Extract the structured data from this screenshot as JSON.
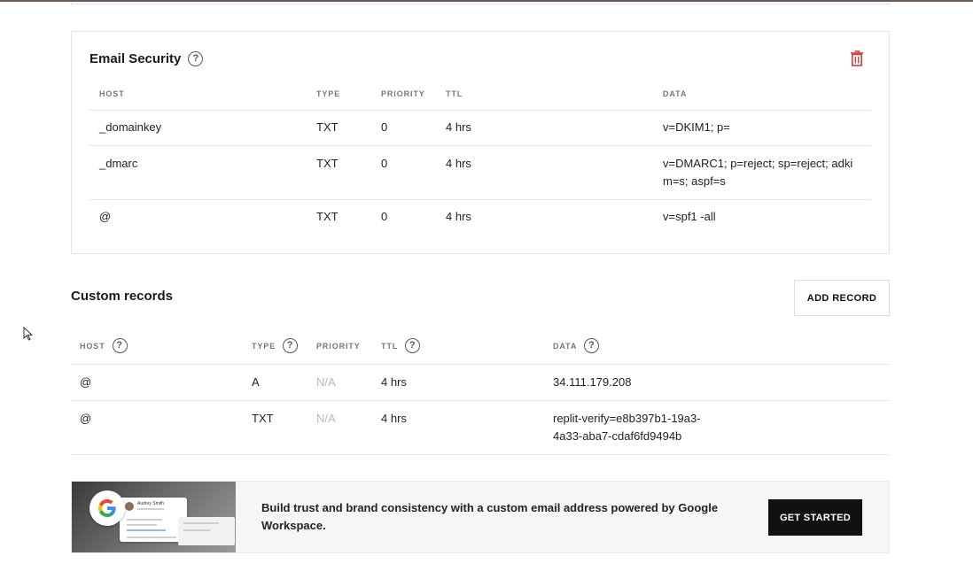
{
  "email_security": {
    "title": "Email Security",
    "help_icon": "?",
    "delete_icon": "trash-icon",
    "columns": [
      "HOST",
      "TYPE",
      "PRIORITY",
      "TTL",
      "DATA"
    ],
    "rows": [
      {
        "host": "_domainkey",
        "type": "TXT",
        "priority": "0",
        "ttl": "4 hrs",
        "data": "v=DKIM1; p="
      },
      {
        "host": "_dmarc",
        "type": "TXT",
        "priority": "0",
        "ttl": "4 hrs",
        "data_line1": "v=DMARC1; p=reject; sp=reject; adki",
        "data_line2": "m=s; aspf=s"
      },
      {
        "host": "@",
        "type": "TXT",
        "priority": "0",
        "ttl": "4 hrs",
        "data": "v=spf1 -all"
      }
    ]
  },
  "custom_records": {
    "title": "Custom records",
    "add_button": "ADD RECORD",
    "columns": [
      "HOST",
      "TYPE",
      "PRIORITY",
      "TTL",
      "DATA"
    ],
    "help_icon": "?",
    "rows": [
      {
        "host": "@",
        "type": "A",
        "priority": "N/A",
        "ttl": "4 hrs",
        "data": "34.111.179.208"
      },
      {
        "host": "@",
        "type": "TXT",
        "priority": "N/A",
        "ttl": "4 hrs",
        "data_line1": "replit-verify=e8b397b1-19a3-",
        "data_line2": "4a33-aba7-cdaf6fd9494b"
      }
    ]
  },
  "banner": {
    "text": "Build trust and brand consistency with a custom email address powered by Google Workspace.",
    "button": "GET STARTED",
    "mock_name": "Audrey Smith",
    "google_icon": "google-logo"
  },
  "colors": {
    "delete_red": "#d23c3c",
    "button_dark": "#111111",
    "muted_text": "#b8b8b8"
  }
}
